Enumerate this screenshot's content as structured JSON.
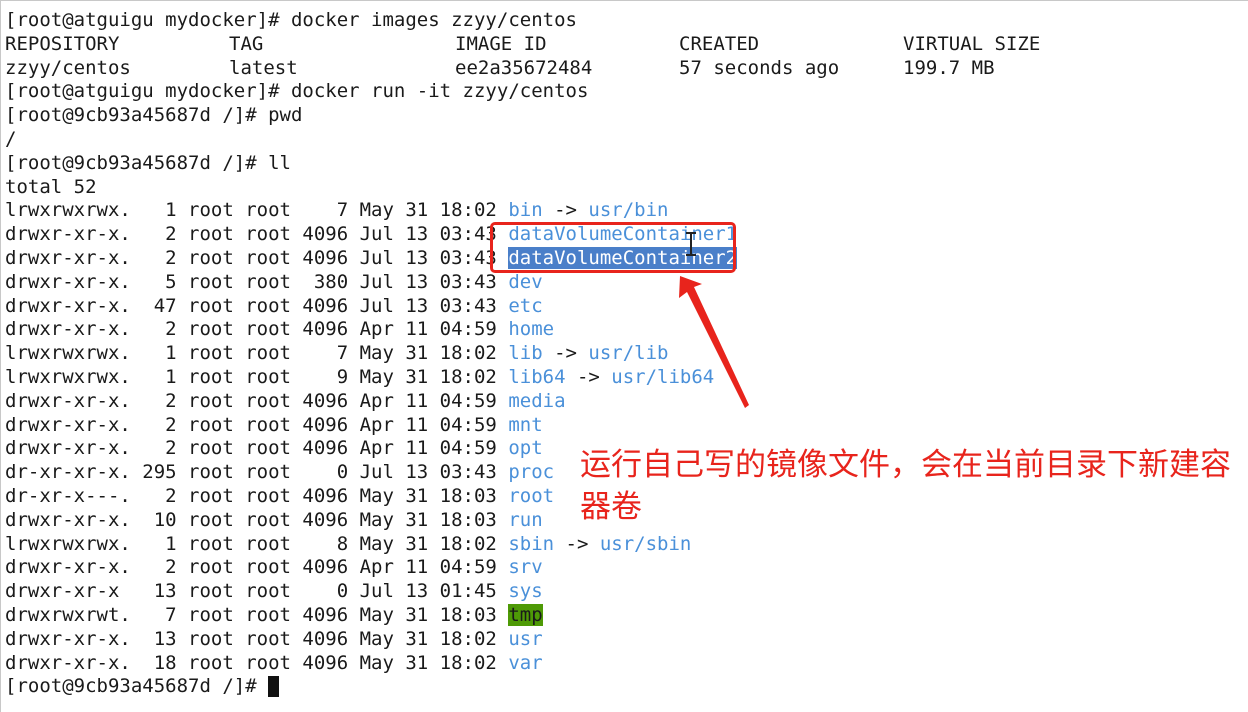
{
  "terminal": {
    "lines": [
      {
        "text": "[root@atguigu mydocker]# docker images zzyy/centos"
      },
      {
        "cols": [
          "REPOSITORY",
          "TAG",
          "IMAGE ID",
          "CREATED",
          "VIRTUAL SIZE"
        ]
      },
      {
        "cols": [
          "zzyy/centos",
          "latest",
          "ee2a35672484",
          "57 seconds ago",
          "199.7 MB"
        ]
      },
      {
        "text": "[root@atguigu mydocker]# docker run -it zzyy/centos"
      },
      {
        "text": "[root@9cb93a45687d /]# pwd"
      },
      {
        "text": "/"
      },
      {
        "text": "[root@9cb93a45687d /]# ll"
      },
      {
        "text": "total 52"
      }
    ],
    "listing": [
      {
        "meta": "lrwxrwxrwx.   1 root root    7 May 31 18:02 ",
        "name": "bin",
        "link": " -> ",
        "target": "usr/bin",
        "style": "blue"
      },
      {
        "meta": "drwxr-xr-x.   2 root root 4096 Jul 13 03:43 ",
        "name": "dataVolumeContainer1",
        "style": "blue"
      },
      {
        "meta": "drwxr-xr-x.   2 root root 4096 Jul 13 03:43 ",
        "name": "dataVolumeContainer2",
        "style": "sel"
      },
      {
        "meta": "drwxr-xr-x.   5 root root  380 Jul 13 03:43 ",
        "name": "dev",
        "style": "blue"
      },
      {
        "meta": "drwxr-xr-x.  47 root root 4096 Jul 13 03:43 ",
        "name": "etc",
        "style": "blue"
      },
      {
        "meta": "drwxr-xr-x.   2 root root 4096 Apr 11 04:59 ",
        "name": "home",
        "style": "blue"
      },
      {
        "meta": "lrwxrwxrwx.   1 root root    7 May 31 18:02 ",
        "name": "lib",
        "link": " -> ",
        "target": "usr/lib",
        "style": "blue"
      },
      {
        "meta": "lrwxrwxrwx.   1 root root    9 May 31 18:02 ",
        "name": "lib64",
        "link": " -> ",
        "target": "usr/lib64",
        "style": "blue"
      },
      {
        "meta": "drwxr-xr-x.   2 root root 4096 Apr 11 04:59 ",
        "name": "media",
        "style": "blue"
      },
      {
        "meta": "drwxr-xr-x.   2 root root 4096 Apr 11 04:59 ",
        "name": "mnt",
        "style": "blue"
      },
      {
        "meta": "drwxr-xr-x.   2 root root 4096 Apr 11 04:59 ",
        "name": "opt",
        "style": "blue"
      },
      {
        "meta": "dr-xr-xr-x. 295 root root    0 Jul 13 03:43 ",
        "name": "proc",
        "style": "blue"
      },
      {
        "meta": "dr-xr-x---.   2 root root 4096 May 31 18:03 ",
        "name": "root",
        "style": "blue"
      },
      {
        "meta": "drwxr-xr-x.  10 root root 4096 May 31 18:03 ",
        "name": "run",
        "style": "blue"
      },
      {
        "meta": "lrwxrwxrwx.   1 root root    8 May 31 18:02 ",
        "name": "sbin",
        "link": " -> ",
        "target": "usr/sbin",
        "style": "blue"
      },
      {
        "meta": "drwxr-xr-x.   2 root root 4096 Apr 11 04:59 ",
        "name": "srv",
        "style": "blue"
      },
      {
        "meta": "drwxr-xr-x   13 root root    0 Jul 13 01:45 ",
        "name": "sys",
        "style": "blue"
      },
      {
        "meta": "drwxrwxrwt.   7 root root 4096 May 31 18:03 ",
        "name": "tmp",
        "style": "tmp"
      },
      {
        "meta": "drwxr-xr-x.  13 root root 4096 May 31 18:02 ",
        "name": "usr",
        "style": "blue"
      },
      {
        "meta": "drwxr-xr-x.  18 root root 4096 May 31 18:02 ",
        "name": "var",
        "style": "blue"
      }
    ],
    "prompt": "[root@9cb93a45687d /]# "
  },
  "annotation": {
    "text": "运行自己写的镜像文件，会在当前目录下新建容器卷",
    "color": "#e8241c"
  },
  "colors": {
    "directory": "#4a90d9",
    "selection": "#4a7fc9",
    "sticky_dir_bg": "#4e9a06",
    "text": "#1a1a1a"
  }
}
